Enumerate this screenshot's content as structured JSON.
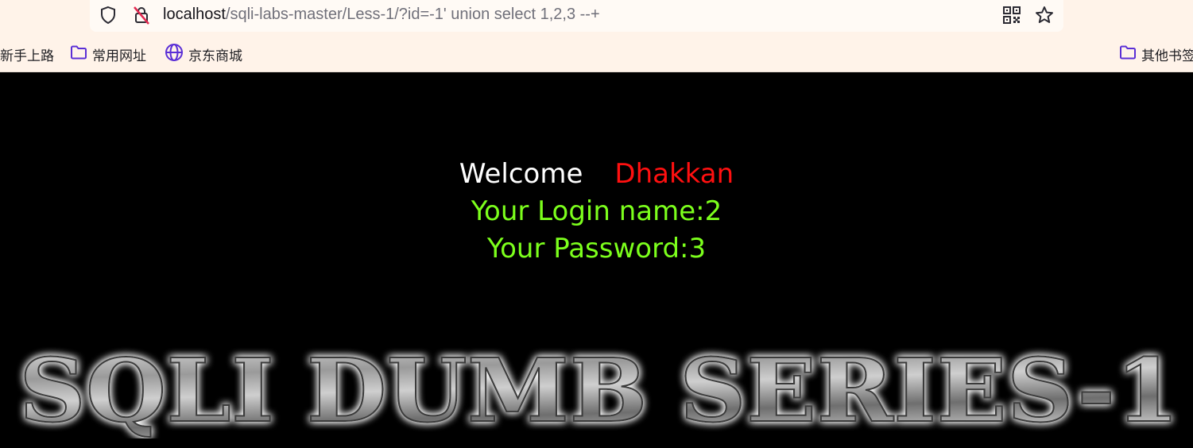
{
  "browser": {
    "url_host": "localhost",
    "url_path": "/sqli-labs-master/Less-1/?id=-1' union select 1,2,3 --+",
    "icons": [
      "shield-icon",
      "insecure-lock-icon",
      "qr-code-icon",
      "bookmark-star-icon"
    ],
    "bookmarks": [
      {
        "label": "新手上路",
        "icon": "none"
      },
      {
        "label": "常用网址",
        "icon": "folder-icon"
      },
      {
        "label": "京东商城",
        "icon": "globe-icon"
      }
    ],
    "other_bookmarks": "其他书签"
  },
  "page": {
    "welcome": "Welcome",
    "username": "Dhakkan",
    "login_line": "Your Login name:2",
    "password_line": "Your Password:3",
    "banner_text": "SQLI DUMB SERIES-1"
  },
  "colors": {
    "background": "#000000",
    "welcome": "#ffffff",
    "username": "#ff1010",
    "result": "#7cff1c",
    "chrome": "#fff3e9",
    "icon_accent": "#5b2fd6"
  }
}
